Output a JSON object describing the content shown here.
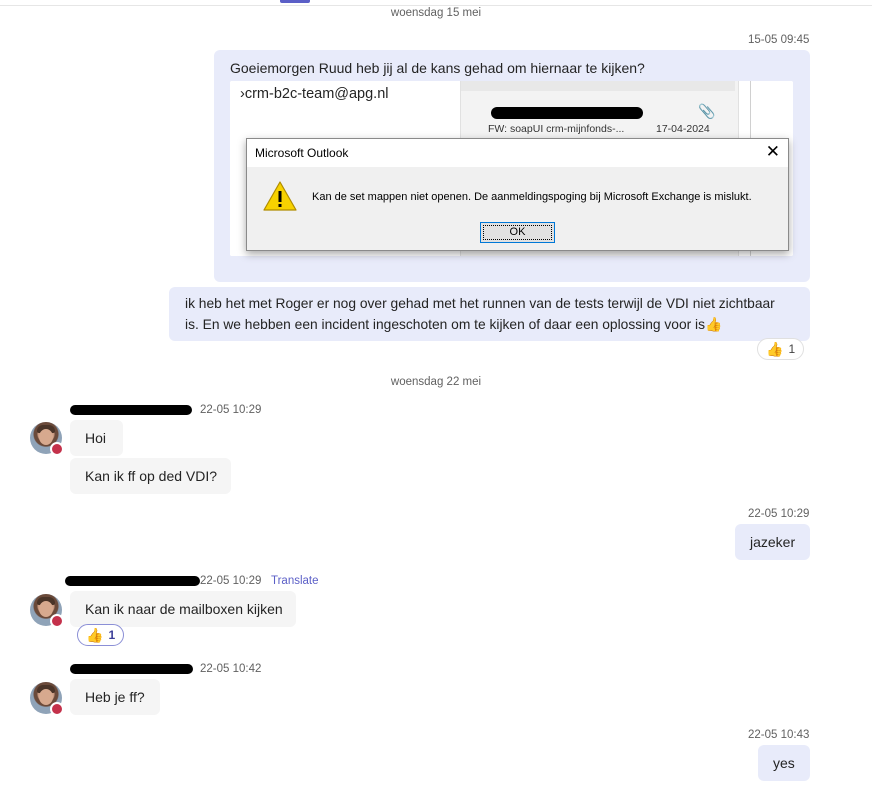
{
  "dates": {
    "first": "woensdag 15 mei",
    "second": "woensdag 22 mei"
  },
  "outgoing": [
    {
      "time": "15-05 09:45",
      "text": "Goeiemorgen Ruud heb jij al de kans gehad om hiernaar te kijken?"
    },
    {
      "text": "ik heb het met Roger er nog over gehad met het runnen van de tests terwijl de VDI niet zichtbaar is. En we hebben een incident ingeschoten om te kijken of daar een oplossing voor is",
      "emoji": "👍"
    },
    {
      "time": "22-05 10:29",
      "text": "jazeker"
    },
    {
      "time": "22-05 10:43",
      "text": "yes"
    }
  ],
  "incoming": [
    {
      "time": "22-05 10:29",
      "messages": [
        "Hoi",
        "Kan ik ff op ded VDI?"
      ]
    },
    {
      "time": "22-05 10:29",
      "translate": "Translate",
      "messages": [
        "Kan ik naar de mailboxen kijken"
      ]
    },
    {
      "time": "22-05 10:42",
      "messages": [
        "Heb je ff?"
      ]
    }
  ],
  "reactions": [
    {
      "emoji": "👍",
      "count": "1"
    },
    {
      "emoji": "👍",
      "count": "1"
    }
  ],
  "screenshot": {
    "folder": "crm-b2c-team@apg.nl",
    "mail_subject": "FW: soapUI crm-mijnfonds-...",
    "mail_date": "17-04-2024",
    "dialog_title": "Microsoft Outlook",
    "dialog_message": "Kan de set mappen niet openen. De aanmeldingspoging bij Microsoft Exchange is mislukt.",
    "dialog_button": "OK"
  },
  "colors": {
    "outgoing_bubble": "#e8ebfa",
    "incoming_bubble": "#f5f5f5",
    "accent": "#5b5fc7",
    "presence_busy": "#c4314b"
  }
}
